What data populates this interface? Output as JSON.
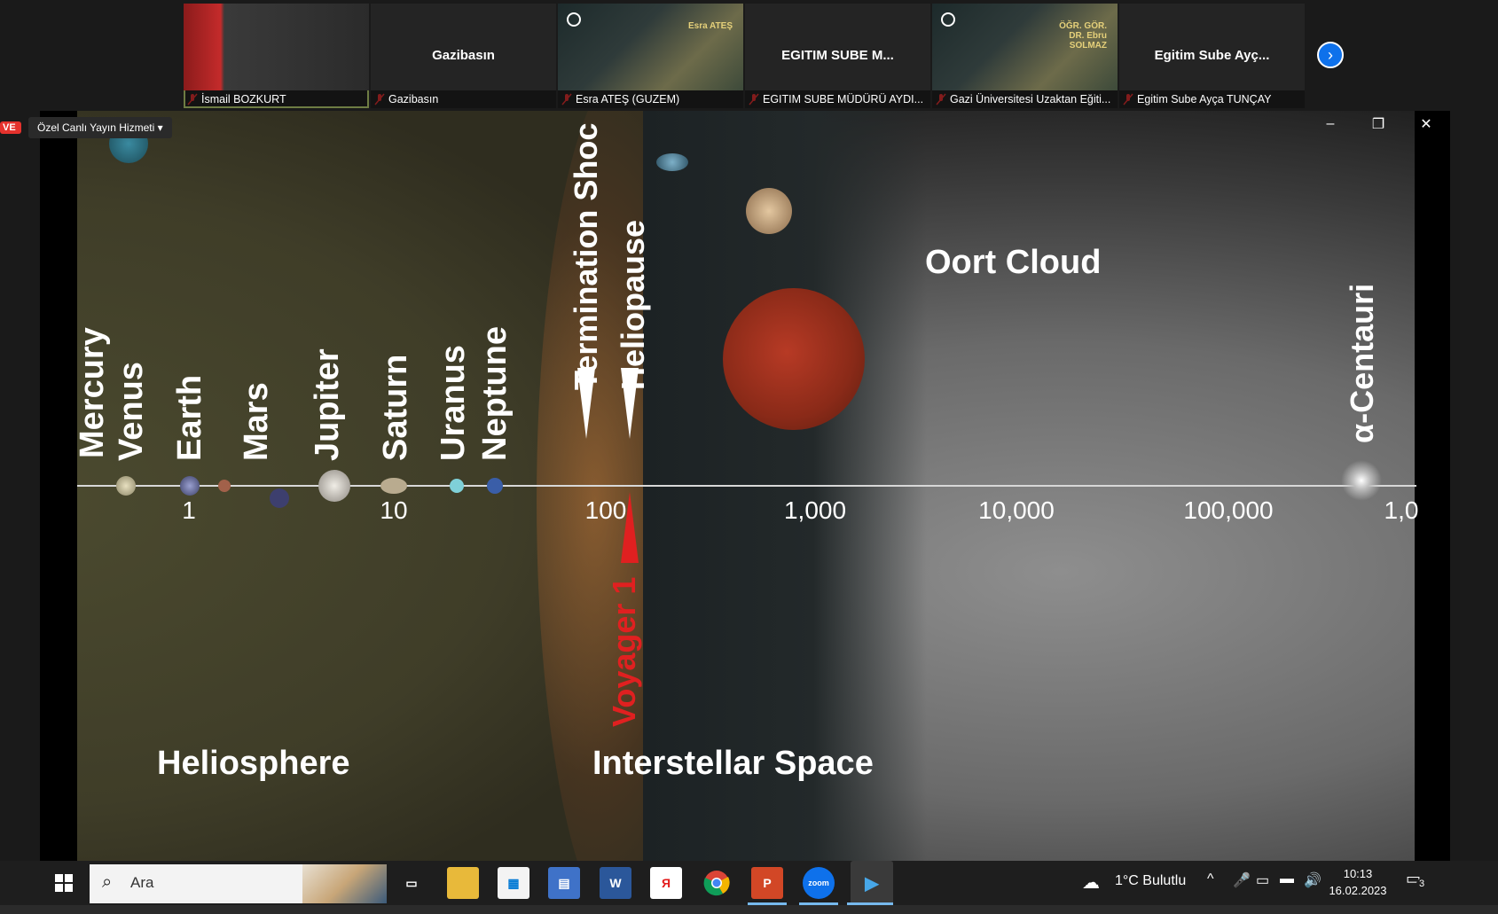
{
  "participants": [
    {
      "name": "İsmail BOZKURT",
      "center_name": "",
      "video": "person"
    },
    {
      "name": "Gazibasın",
      "center_name": "Gazibasın",
      "video": "none"
    },
    {
      "name": "Esra ATEŞ (GUZEM)",
      "center_name": "",
      "video": "slide",
      "slide_label": "Esra ATEŞ"
    },
    {
      "name": "EGITIM SUBE MÜDÜRÜ AYDI...",
      "center_name": "EGITIM SUBE M...",
      "video": "none"
    },
    {
      "name": "Gazi Üniversitesi Uzaktan Eğiti...",
      "center_name": "",
      "video": "slide",
      "slide_label": "ÖĞR. GÖR. DR. Ebru SOLMAZ"
    },
    {
      "name": "Egitim Sube Ayça TUNÇAY",
      "center_name": "Egitim Sube Ayç...",
      "video": "none"
    }
  ],
  "share": {
    "live_badge": "VE",
    "stream_menu": "Özel Canlı Yayın Hizmeti ▾",
    "window_controls": {
      "minimize": "–",
      "restore": "❐",
      "close": "✕"
    }
  },
  "slide": {
    "planets": [
      "Mercury",
      "Venus",
      "Earth",
      "Mars",
      "Jupiter",
      "Saturn",
      "Uranus",
      "Neptune"
    ],
    "markers": [
      "Termination Shoc",
      "Heliopause",
      "Voyager 1"
    ],
    "ticks": [
      "1",
      "10",
      "100",
      "1,000",
      "10,000",
      "100,000",
      "1,0"
    ],
    "oort": "Oort Cloud",
    "star": "α-Centauri",
    "regions": {
      "left": "Heliosphere",
      "right": "Interstellar Space"
    },
    "colors": {
      "heliosphere": "#403e29",
      "voyager": "#e02020"
    }
  },
  "taskbar": {
    "search_placeholder": "Ara",
    "apps": [
      "windows-start",
      "task-view",
      "file-explorer",
      "microsoft-store",
      "calculator",
      "word",
      "yandex",
      "chrome",
      "powerpoint",
      "zoom",
      "media-player"
    ],
    "weather": "1°C  Bulutlu",
    "time": "10:13",
    "date": "16.02.2023",
    "notifications": "3"
  }
}
